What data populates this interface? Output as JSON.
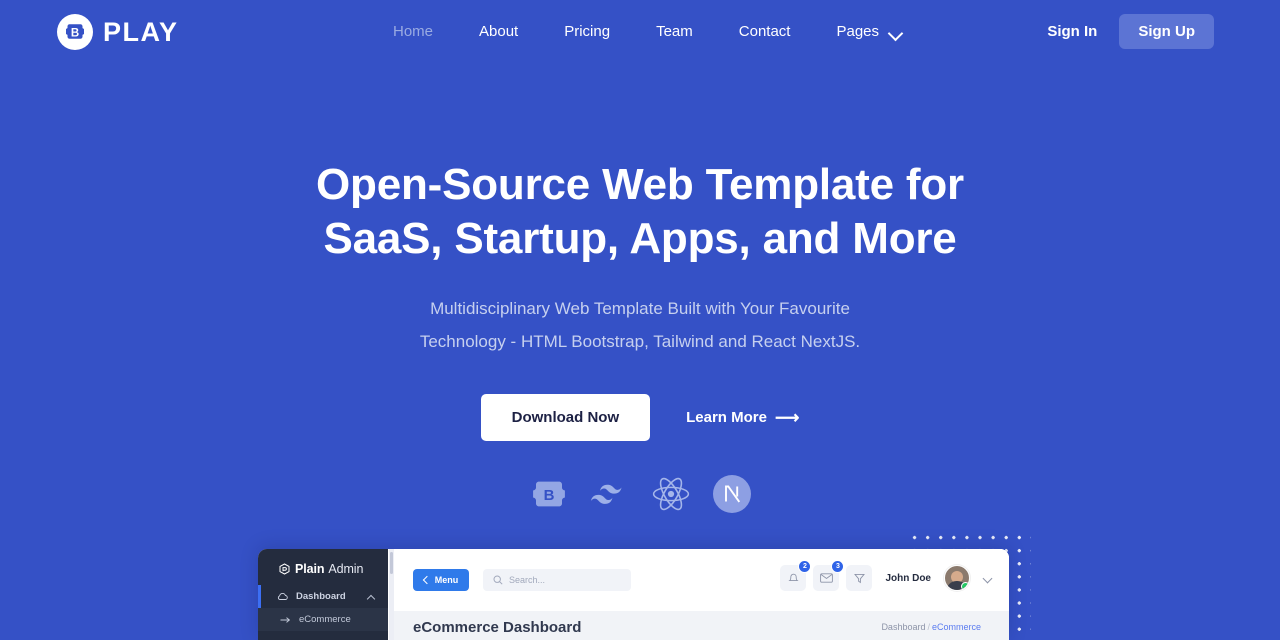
{
  "theme": {
    "bg_blue": "#3551c6",
    "accent_light": "#5c74d4",
    "muted_nav": "#9aabe2",
    "subtitle": "#c6d0ef"
  },
  "header": {
    "brand": {
      "name": "PLAY",
      "mark_letter": "B",
      "mark_icon": "bootstrap-b-logo"
    },
    "nav": [
      {
        "label": "Home",
        "active": true
      },
      {
        "label": "About",
        "active": false
      },
      {
        "label": "Pricing",
        "active": false
      },
      {
        "label": "Team",
        "active": false
      },
      {
        "label": "Contact",
        "active": false
      },
      {
        "label": "Pages",
        "active": false,
        "has_dropdown": true
      }
    ],
    "sign_in": "Sign In",
    "sign_up": "Sign Up"
  },
  "hero": {
    "title_line1": "Open-Source Web Template for",
    "title_line2": "SaaS, Startup, Apps, and More",
    "subtitle_line1": "Multidisciplinary Web Template Built with Your Favourite",
    "subtitle_line2": "Technology - HTML Bootstrap, Tailwind and React NextJS.",
    "primary_cta": "Download Now",
    "secondary_cta": "Learn More",
    "secondary_cta_arrow": "⟶",
    "tech_icons": [
      {
        "name": "bootstrap-icon",
        "letter": "B"
      },
      {
        "name": "tailwind-icon",
        "letter": ""
      },
      {
        "name": "react-icon",
        "letter": ""
      },
      {
        "name": "nextjs-icon",
        "letter": "N"
      }
    ]
  },
  "dashboard_preview": {
    "sidebar": {
      "logo_bold": "Plain",
      "logo_light": "Admin",
      "items": [
        {
          "label": "Dashboard",
          "icon": "cloud-icon",
          "active": true,
          "expanded": true
        },
        {
          "label": "eCommerce",
          "icon": "arrow-right-icon",
          "active": false,
          "sub": true
        }
      ]
    },
    "topbar": {
      "menu_button": "Menu",
      "search_placeholder": "Search...",
      "notification_count": "2",
      "message_count": "3",
      "user_name": "John Doe"
    },
    "content": {
      "page_title": "eCommerce Dashboard",
      "breadcrumb_root": "Dashboard",
      "breadcrumb_sep": "/",
      "breadcrumb_current": "eCommerce"
    }
  }
}
